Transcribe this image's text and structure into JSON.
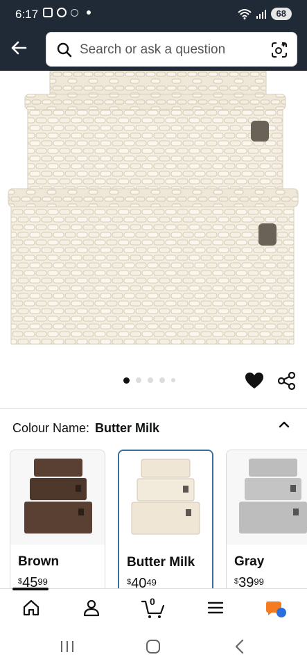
{
  "status_bar": {
    "time": "6:17",
    "battery": "68"
  },
  "search": {
    "placeholder": "Search or ask a question"
  },
  "gallery": {
    "total_images": 5,
    "active_index": 0
  },
  "colour": {
    "label": "Colour Name:",
    "selected": "Butter Milk"
  },
  "variants": [
    {
      "name": "Brown",
      "price_symbol": "$",
      "price_whole": "45",
      "price_cents": "99",
      "color": "#5a4033"
    },
    {
      "name": "Butter Milk",
      "price_symbol": "$",
      "price_whole": "40",
      "price_cents": "49",
      "color": "#efe6d6"
    },
    {
      "name": "Gray",
      "price_symbol": "$",
      "price_whole": "39",
      "price_cents": "99",
      "color": "#bdbdbd"
    }
  ],
  "cart": {
    "count": "0"
  },
  "colors": {
    "header_bg": "#1f2a36",
    "selected_border": "#3a6f9b",
    "rufus_orange": "#f47b20",
    "rufus_blue": "#2a6fdb"
  }
}
